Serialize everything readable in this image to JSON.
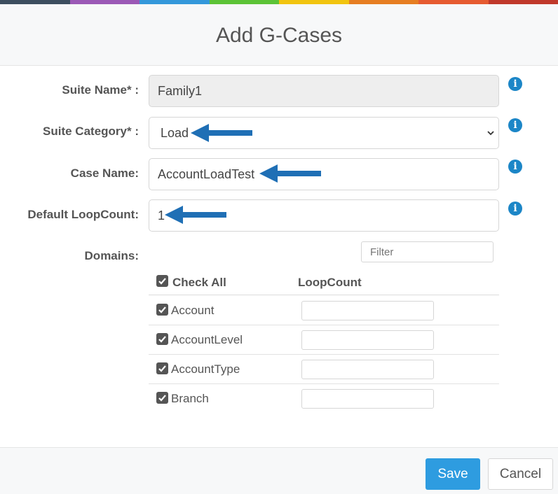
{
  "colors": {
    "topbar": [
      "#3d4e5f",
      "#9b59b6",
      "#3498db",
      "#5cc337",
      "#f1c40f",
      "#e67e22",
      "#e65b31",
      "#c0392b"
    ],
    "arrow": "#1f6fb5",
    "primary": "#2e9ce0",
    "info": "#1c86c7"
  },
  "dialog": {
    "title": "Add G-Cases"
  },
  "form": {
    "suite_name": {
      "label": "Suite Name* :",
      "value": "Family1"
    },
    "suite_category": {
      "label": "Suite Category* :",
      "value": "Load"
    },
    "case_name": {
      "label": "Case Name:",
      "value": "AccountLoadTest"
    },
    "default_loopcount": {
      "label": "Default LoopCount:",
      "value": "1"
    },
    "domains": {
      "label": "Domains:",
      "filter_placeholder": "Filter",
      "check_all_label": "Check All",
      "loopcount_header": "LoopCount",
      "items": [
        {
          "name": "Account",
          "checked": true,
          "loopcount": ""
        },
        {
          "name": "AccountLevel",
          "checked": true,
          "loopcount": ""
        },
        {
          "name": "AccountType",
          "checked": true,
          "loopcount": ""
        },
        {
          "name": "Branch",
          "checked": true,
          "loopcount": ""
        }
      ]
    }
  },
  "icons": {
    "info": "info-icon",
    "dropdown": "chevron-down-icon",
    "checkbox": "checkbox-checked-icon",
    "annotation": "arrow-left-icon"
  },
  "footer": {
    "save_label": "Save",
    "cancel_label": "Cancel"
  }
}
